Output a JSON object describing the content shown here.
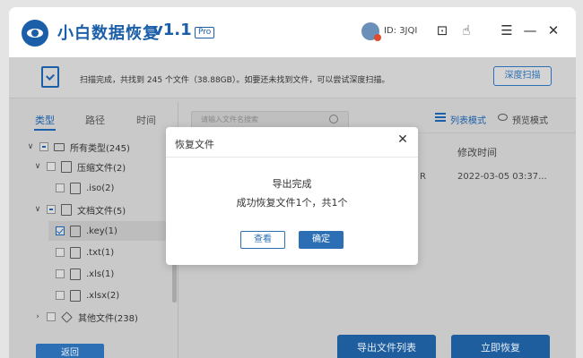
{
  "app": {
    "title": "小白数据恢复",
    "version": "v1.1",
    "badge": "Pro",
    "user_id": "ID: 3JQI",
    "window_icons": [
      "user-avatar-icon",
      "robot-icon",
      "hand-pointer-icon",
      "menu-icon",
      "minimize-icon",
      "close-icon"
    ]
  },
  "scan": {
    "message": "扫描完成，共找到 245 个文件（38.88GB）。如要还未找到文件，可以尝试深度扫描。",
    "deep_scan_label": "深度扫描"
  },
  "filter_tabs": [
    "类型",
    "路径",
    "时间"
  ],
  "tree": [
    {
      "label": "所有类型(245)",
      "expanded": true,
      "checkbox": "partial",
      "icon": "drive-icon"
    },
    {
      "label": "压缩文件(2)",
      "expanded": true,
      "checkbox": "unchecked",
      "icon": "archive-icon"
    },
    {
      "label": ".iso(2)",
      "checkbox": "unchecked",
      "icon": "file-icon"
    },
    {
      "label": "文档文件(5)",
      "expanded": true,
      "checkbox": "partial",
      "icon": "document-icon"
    },
    {
      "label": ".key(1)",
      "checkbox": "checked",
      "icon": "document-icon",
      "selected": true
    },
    {
      "label": ".txt(1)",
      "checkbox": "unchecked",
      "icon": "document-icon"
    },
    {
      "label": ".xls(1)",
      "checkbox": "unchecked",
      "icon": "document-icon"
    },
    {
      "label": ".xlsx(2)",
      "checkbox": "unchecked",
      "icon": "document-icon"
    },
    {
      "label": "其他文件(238)",
      "expanded": false,
      "checkbox": "unchecked",
      "icon": "diamond-icon"
    }
  ],
  "search": {
    "placeholder": "请输入文件名搜索"
  },
  "view_modes": {
    "list": "列表模式",
    "preview": "预览模式"
  },
  "table": {
    "column_modified": "修改时间",
    "row_type_fragment": "R",
    "row_modified": "2022-03-05 03:37..."
  },
  "buttons": {
    "back": "返回",
    "export_list": "导出文件列表",
    "recover_now": "立即恢复"
  },
  "dialog": {
    "title": "恢复文件",
    "message_line1": "导出完成",
    "message_line2": "成功恢复文件1个，共1个",
    "view_label": "查看",
    "ok_label": "确定"
  },
  "colors": {
    "brand": "#1b5fa8",
    "button": "#2c6fb4",
    "overlay": "#c9c9c9"
  }
}
